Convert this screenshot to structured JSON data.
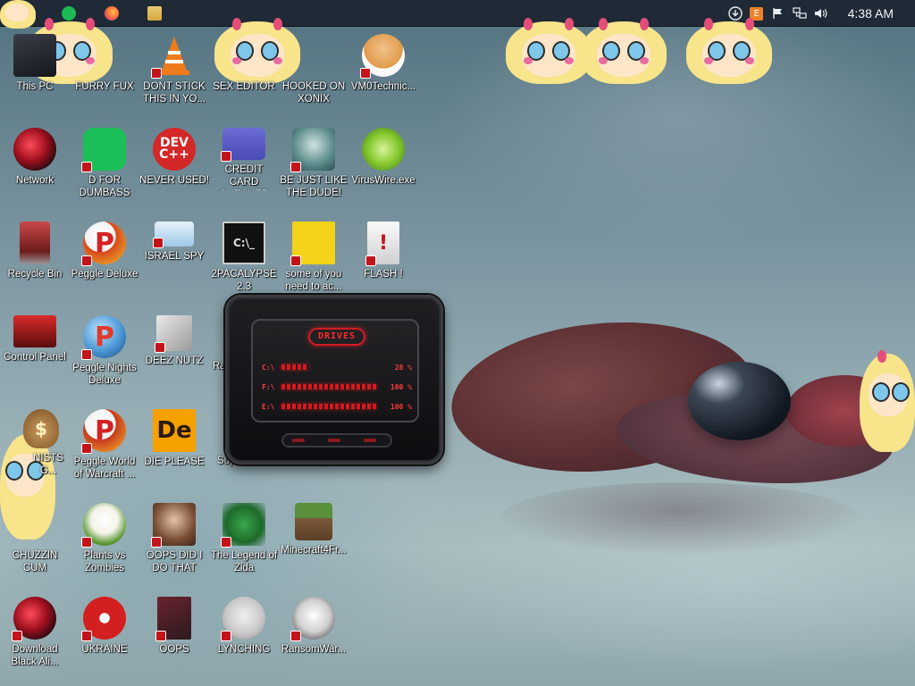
{
  "taskbar": {
    "apps": [
      {
        "name": "spotify-icon"
      },
      {
        "name": "firefox-icon"
      },
      {
        "name": "file-explorer-icon"
      }
    ],
    "tray_orange_badge": "E",
    "clock": "4:38 AM"
  },
  "desktop": {
    "icons": [
      {
        "label": "This PC"
      },
      {
        "label": "FURRY FUX"
      },
      {
        "label": "DONT STICK THIS IN YO..."
      },
      {
        "label": "SEX EDITOR"
      },
      {
        "label": "HOOKED ON XONIX"
      },
      {
        "label": "VM0Technic..."
      },
      {
        "label": "Network"
      },
      {
        "label": "D FOR DUMBASS"
      },
      {
        "label": "NEVER USED!"
      },
      {
        "label": "CREDIT CARD CHECKER"
      },
      {
        "label": "BE JUST LIKE THE DUDE!"
      },
      {
        "label": "VirusWire.exe"
      },
      {
        "label": "Recycle Bin"
      },
      {
        "label": "Peggle Deluxe"
      },
      {
        "label": "ISRAEL SPY"
      },
      {
        "label": "2PACALYPSE 2.3"
      },
      {
        "label": "some of you need to ac..."
      },
      {
        "label": "FLASH !"
      },
      {
        "label": "Control Panel"
      },
      {
        "label": "Peggle Nights Deluxe"
      },
      {
        "label": "DEEZ NUTZ"
      },
      {
        "label": "Ra Me"
      },
      {
        "label": "NISTS G..."
      },
      {
        "label": "Peggle World of Warcraft ..."
      },
      {
        "label": "DIE PLEASE"
      },
      {
        "label": "Supe"
      },
      {
        "label": "CHUZZIN CUM"
      },
      {
        "label": "Plants vs Zombies"
      },
      {
        "label": "OOPS DID I DO THAT"
      },
      {
        "label": "The Legend of Zlda"
      },
      {
        "label": "Minecraft4Fr..."
      },
      {
        "label": "Download Black Ali..."
      },
      {
        "label": "UKRAINE"
      },
      {
        "label": "OOPS"
      },
      {
        "label": "LYNCHING"
      },
      {
        "label": "RansomWar..."
      }
    ],
    "dev_icon_text": "DEV C++",
    "peggle_letter": "P",
    "de_icon_text": "De",
    "cmd_icon_text": "C:\\_",
    "money_icon_text": "$"
  },
  "drives_gadget": {
    "title": "DRIVES",
    "drives": [
      {
        "letter": "C:\\",
        "percent_text": "28 %",
        "fill": 0.28
      },
      {
        "letter": "F:\\",
        "percent_text": "100 %",
        "fill": 1.0
      },
      {
        "letter": "E:\\",
        "percent_text": "100 %",
        "fill": 1.0
      }
    ]
  },
  "colors": {
    "taskbar": "#1f2a36",
    "gadget_accent": "#e0141c"
  }
}
